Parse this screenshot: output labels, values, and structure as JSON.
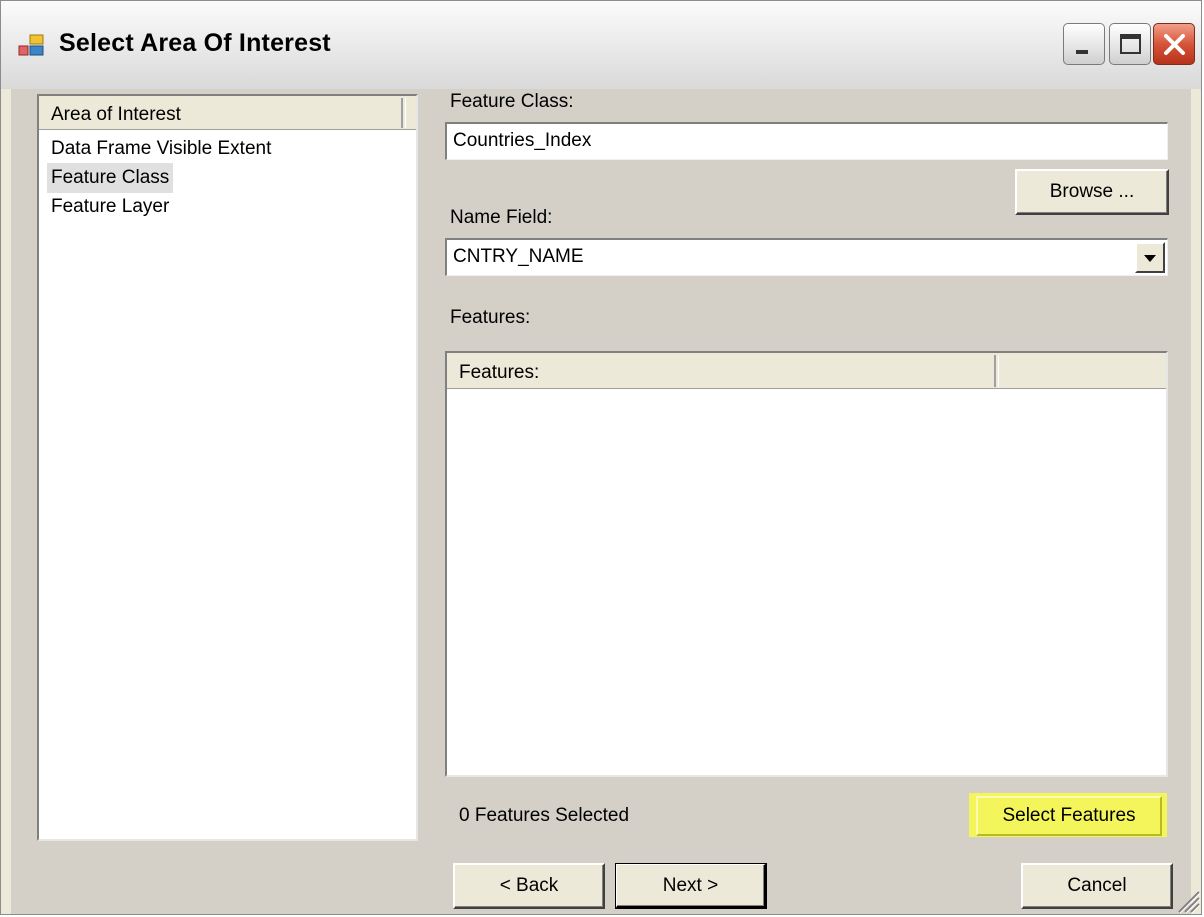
{
  "window": {
    "title": "Select Area Of Interest"
  },
  "aoi_list": {
    "header": "Area of Interest",
    "items": [
      {
        "label": "Data Frame Visible Extent",
        "selected": false
      },
      {
        "label": "Feature Class",
        "selected": true
      },
      {
        "label": "Feature Layer",
        "selected": false
      }
    ]
  },
  "feature_class": {
    "label": "Feature Class:",
    "value": "Countries_Index",
    "browse_label": "Browse ..."
  },
  "name_field": {
    "label": "Name Field:",
    "value": "CNTRY_NAME"
  },
  "features": {
    "label": "Features:",
    "column_header": "Features:",
    "rows": []
  },
  "status": {
    "selected_count_text": "0 Features Selected"
  },
  "buttons": {
    "select_features": "Select Features",
    "back": "< Back",
    "next": "Next >",
    "cancel": "Cancel"
  },
  "colors": {
    "highlight": "#f3f55a",
    "close_button": "#d6543a"
  }
}
